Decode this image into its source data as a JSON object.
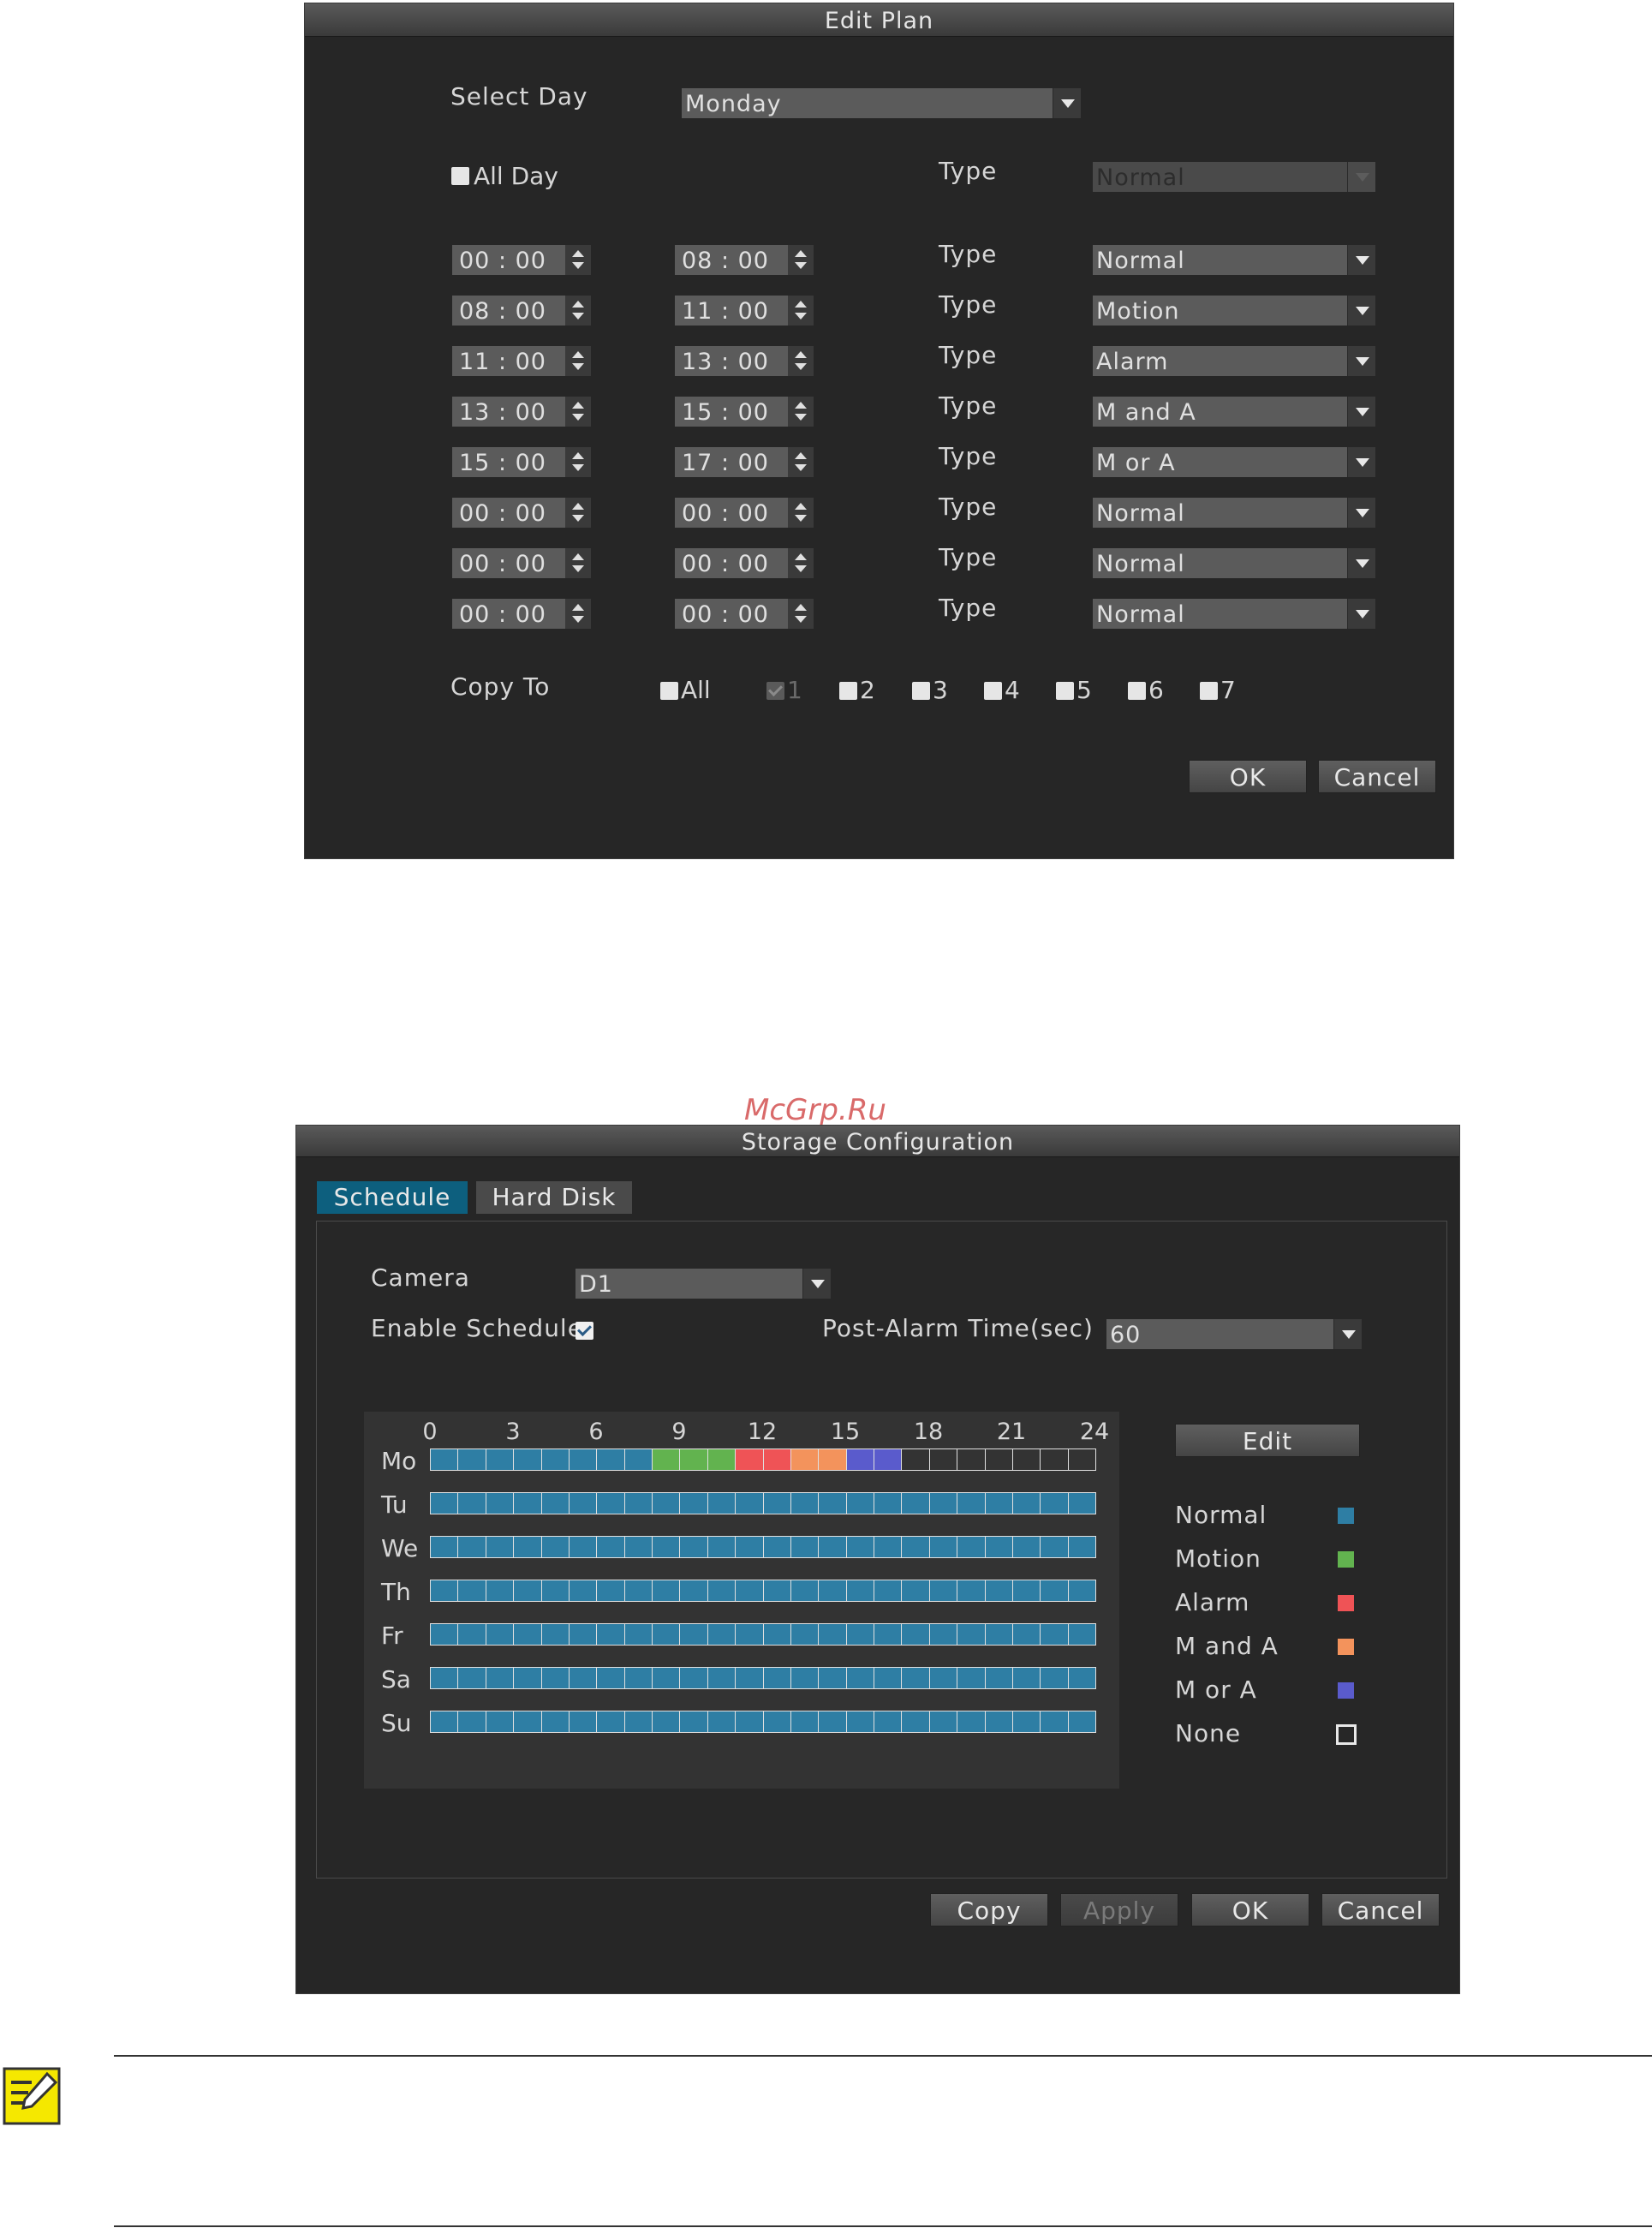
{
  "edit_plan": {
    "title": "Edit Plan",
    "select_day_label": "Select Day",
    "select_day_value": "Monday",
    "all_day_label": "All Day",
    "type_label": "Type",
    "all_day_type_value": "Normal",
    "periods": [
      {
        "start": "00 : 00",
        "end": "08 : 00",
        "type": "Normal"
      },
      {
        "start": "08 : 00",
        "end": "11 : 00",
        "type": "Motion"
      },
      {
        "start": "11 : 00",
        "end": "13 : 00",
        "type": "Alarm"
      },
      {
        "start": "13 : 00",
        "end": "15 : 00",
        "type": "M and A"
      },
      {
        "start": "15 : 00",
        "end": "17 : 00",
        "type": "M or A"
      },
      {
        "start": "00 : 00",
        "end": "00 : 00",
        "type": "Normal"
      },
      {
        "start": "00 : 00",
        "end": "00 : 00",
        "type": "Normal"
      },
      {
        "start": "00 : 00",
        "end": "00 : 00",
        "type": "Normal"
      }
    ],
    "copy_to_label": "Copy To",
    "copy_to_options": [
      {
        "label": "All",
        "checked": false,
        "disabled": false
      },
      {
        "label": "1",
        "checked": true,
        "disabled": true
      },
      {
        "label": "2",
        "checked": false,
        "disabled": false
      },
      {
        "label": "3",
        "checked": false,
        "disabled": false
      },
      {
        "label": "4",
        "checked": false,
        "disabled": false
      },
      {
        "label": "5",
        "checked": false,
        "disabled": false
      },
      {
        "label": "6",
        "checked": false,
        "disabled": false
      },
      {
        "label": "7",
        "checked": false,
        "disabled": false
      }
    ],
    "ok_label": "OK",
    "cancel_label": "Cancel"
  },
  "watermark": "McGrp.Ru",
  "storage_config": {
    "title": "Storage Configuration",
    "tabs": [
      {
        "label": "Schedule",
        "active": true
      },
      {
        "label": "Hard Disk",
        "active": false
      }
    ],
    "camera_label": "Camera",
    "camera_value": "D1",
    "enable_schedule_label": "Enable Schedule",
    "enable_schedule_checked": true,
    "post_alarm_label": "Post-Alarm Time(sec)",
    "post_alarm_value": "60",
    "hour_labels": [
      "0",
      "3",
      "6",
      "9",
      "12",
      "15",
      "18",
      "21",
      "24"
    ],
    "days": [
      "Mo",
      "Tu",
      "We",
      "Th",
      "Fr",
      "Sa",
      "Su"
    ],
    "monday_schedule": [
      "Normal",
      "Normal",
      "Normal",
      "Normal",
      "Normal",
      "Normal",
      "Normal",
      "Normal",
      "Motion",
      "Motion",
      "Motion",
      "Alarm",
      "Alarm",
      "M and A",
      "M and A",
      "M or A",
      "M or A",
      "None",
      "None",
      "None",
      "None",
      "None",
      "None",
      "None"
    ],
    "other_days_type": "Normal",
    "edit_label": "Edit",
    "legend": [
      {
        "label": "Normal",
        "color": "#2e7ea4"
      },
      {
        "label": "Motion",
        "color": "#62b34f"
      },
      {
        "label": "Alarm",
        "color": "#ef5356"
      },
      {
        "label": "M and A",
        "color": "#f3935c"
      },
      {
        "label": "M or A",
        "color": "#5a5bcc"
      },
      {
        "label": "None",
        "color": "none"
      }
    ],
    "copy_label": "Copy",
    "apply_label": "Apply",
    "ok_label": "OK",
    "cancel_label": "Cancel"
  }
}
